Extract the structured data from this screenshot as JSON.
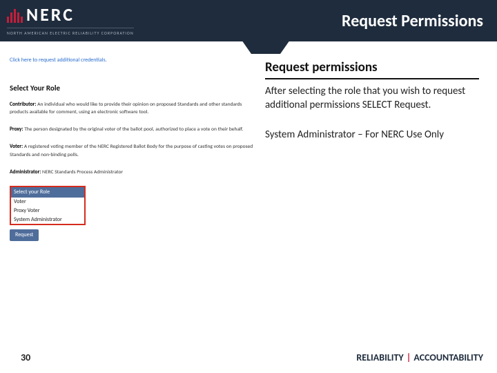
{
  "header": {
    "logo_main": "NERC",
    "logo_sub": "NORTH AMERICAN ELECTRIC RELIABILITY CORPORATION",
    "title": "Request Permissions"
  },
  "left": {
    "link_text": "Click here to request additional credentials.",
    "section_title": "Select Your Role",
    "roles": {
      "contributor_label": "Contributor:",
      "contributor_text": " An individual who would like to provide their opinion on proposed Standards and other standards products available for comment, using an electronic software tool.",
      "proxy_label": "Proxy:",
      "proxy_text": " The person designated by the original voter of the ballot pool, authorized to place a vote on their behalf.",
      "voter_label": "Voter:",
      "voter_text": " A registered voting member of the NERC Registered Ballot Body for the purpose of casting votes on proposed Standards and non-binding polls.",
      "admin_label": "Administrator:",
      "admin_text": " NERC Standards Process Administrator"
    },
    "dropdown": {
      "header": "Select your Role",
      "opt1": "Voter",
      "opt2": "Proxy Voter",
      "opt3": "System Administrator"
    },
    "request_btn": "Request"
  },
  "right": {
    "title": "Request permissions",
    "body1": "After selecting the role that you wish to request additional permissions SELECT Request.",
    "body2": "System Administrator – For NERC Use Only"
  },
  "footer": {
    "page": "30",
    "motto_left": "RELIABILITY",
    "motto_sep": "|",
    "motto_right": "ACCOUNTABILITY"
  }
}
